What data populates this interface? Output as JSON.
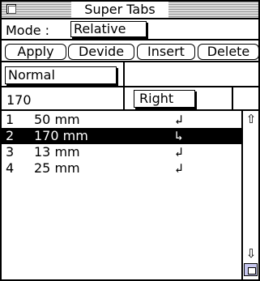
{
  "window": {
    "title": "Super Tabs"
  },
  "mode": {
    "label": "Mode :",
    "value": "Relative"
  },
  "buttons": {
    "apply": "Apply",
    "devide": "Devide",
    "insert": "Insert",
    "delete": "Delete"
  },
  "style": {
    "value": "Normal"
  },
  "position": {
    "value": "170",
    "alignment": "Right"
  },
  "tabs": [
    {
      "index": "1",
      "distance": "50 mm",
      "glyph": "↲",
      "selected": false
    },
    {
      "index": "2",
      "distance": "170 mm",
      "glyph": "↳",
      "selected": true
    },
    {
      "index": "3",
      "distance": "13 mm",
      "glyph": "↲",
      "selected": false
    },
    {
      "index": "4",
      "distance": "25 mm",
      "glyph": "↲",
      "selected": false
    }
  ],
  "scrollbar": {
    "up_icon": "⇧",
    "down_icon": "⇩"
  },
  "colors": {
    "selection": "#000000",
    "titlebar_stripe": "#9a9a9a",
    "grow_box": "#c8c8f0"
  }
}
